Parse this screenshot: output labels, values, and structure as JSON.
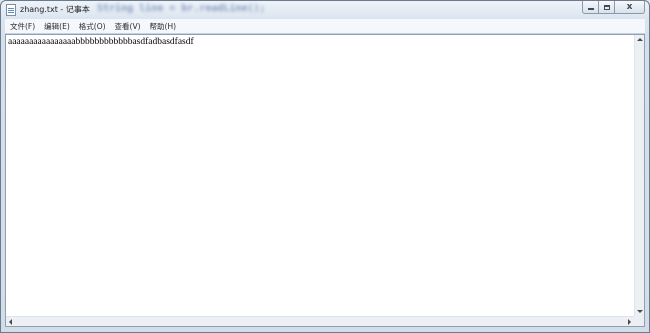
{
  "window": {
    "title": "zhang.txt - 记事本",
    "background_text": "String line = br.readLine();",
    "close_glyph": "x"
  },
  "menu": {
    "items": [
      {
        "label": "文件(F)"
      },
      {
        "label": "编辑(E)"
      },
      {
        "label": "格式(O)"
      },
      {
        "label": "查看(V)"
      },
      {
        "label": "帮助(H)"
      }
    ]
  },
  "editor": {
    "content": "aaaaaaaaaaaaaaaabbbbbbbbbbbbasdfadbasdfasdf"
  },
  "icons": {
    "app": "notepad-icon",
    "minimize": "minimize-icon",
    "maximize": "maximize-icon",
    "close": "close-icon"
  },
  "colors": {
    "window_frame": "#dbe5ef",
    "editor_bg": "#ffffff",
    "text": "#000000"
  }
}
